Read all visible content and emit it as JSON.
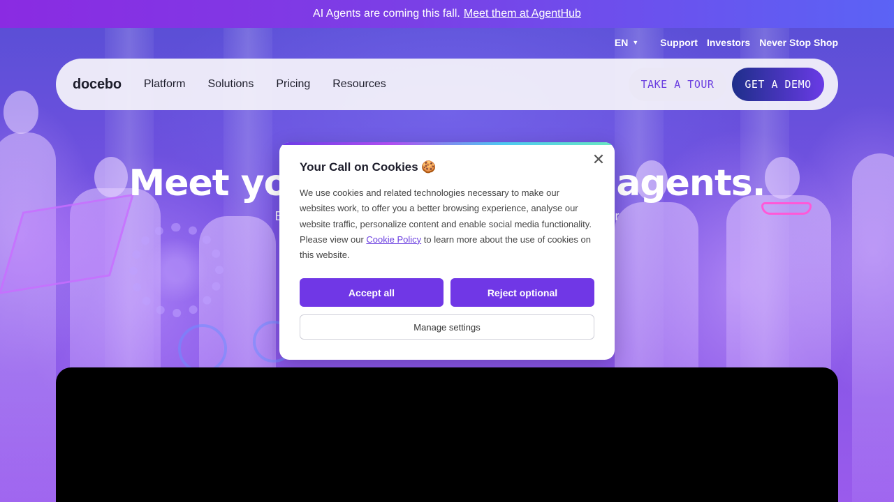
{
  "announcement": {
    "text": "AI Agents are coming this fall.",
    "link": "Meet them at AgentHub"
  },
  "utility_nav": {
    "language": "EN",
    "links": [
      "Support",
      "Investors",
      "Never Stop Shop"
    ]
  },
  "navbar": {
    "logo": "docebo",
    "links": [
      "Platform",
      "Solutions",
      "Pricing",
      "Resources"
    ],
    "tour_label": "TAKE A TOUR",
    "demo_label": "GET A DEMO"
  },
  "hero": {
    "title_left": "Meet yo",
    "title_right": "agents.",
    "subtitle_left": "B",
    "subtitle_right": "r"
  },
  "cookie_modal": {
    "title": "Your Call on Cookies 🍪",
    "body_before_link": "We use cookies and related technologies necessary to make our websites work, to offer you a better browsing experience, analyse our website traffic, personalize content and enable social media functionality. Please view our ",
    "link_text": "Cookie Policy",
    "body_after_link": " to learn more about the use of cookies on this website.",
    "accept_label": "Accept all",
    "reject_label": "Reject optional",
    "manage_label": "Manage settings"
  },
  "colors": {
    "accent": "#7037e6",
    "announcement_gradient_start": "#8a2be2",
    "announcement_gradient_end": "#5b63f5"
  }
}
